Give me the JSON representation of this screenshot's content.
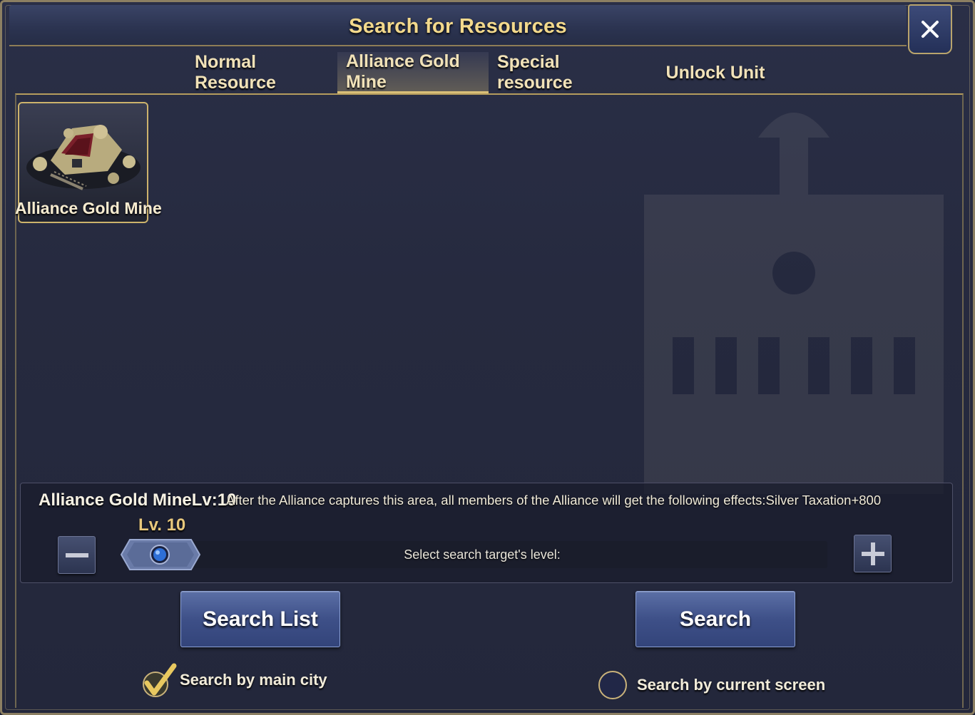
{
  "window": {
    "title": "Search for Resources",
    "close_icon": "close-icon"
  },
  "tabs": [
    {
      "label": "Normal Resource",
      "active": false
    },
    {
      "label": "Alliance Gold Mine",
      "active": true
    },
    {
      "label": "Special resource",
      "active": false
    },
    {
      "label": "Unlock Unit",
      "active": false
    }
  ],
  "resources": [
    {
      "label": "Alliance Gold Mine",
      "icon": "gold-mine-icon",
      "selected": true
    }
  ],
  "info": {
    "title": "Alliance Gold MineLv:10",
    "effect": "After the Alliance captures this area, all members of the Alliance will get the following effects:Silver Taxation+800"
  },
  "level_selector": {
    "current_label": "Lv. 10",
    "current_level": 10,
    "track_label": "Select search target's level:",
    "minus_icon": "minus-icon",
    "plus_icon": "plus-icon"
  },
  "buttons": {
    "search_list": "Search List",
    "search": "Search"
  },
  "options": {
    "main_city": {
      "label": "Search by main city",
      "checked": true
    },
    "current_screen": {
      "label": "Search by current screen",
      "checked": false
    }
  },
  "colors": {
    "accent_gold": "#f3d98c",
    "button_blue": "#3e5088",
    "panel_bg": "#262a3f"
  }
}
